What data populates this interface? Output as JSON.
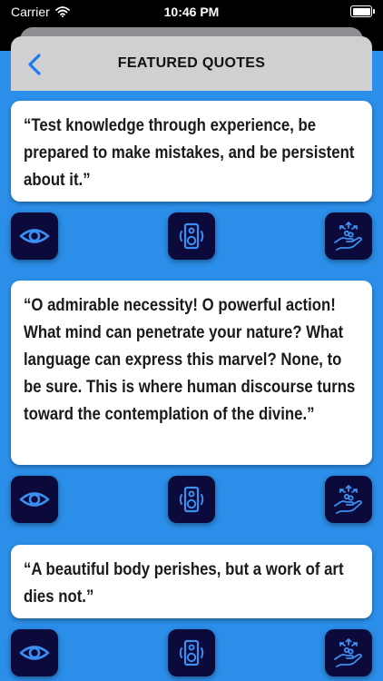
{
  "status_bar": {
    "carrier": "Carrier",
    "time": "10:46 PM"
  },
  "header": {
    "title": "FEATURED QUOTES",
    "back_icon": "chevron-left-icon"
  },
  "quotes": [
    {
      "text": "“Test knowledge through experience, be prepared to make mistakes, and be persistent about it.”"
    },
    {
      "text": "“O admirable necessity! O powerful action! What mind can penetrate your nature? What language can express this marvel? None, to be sure. This is where human discourse turns toward the contemplation of the divine.”"
    },
    {
      "text": "“A beautiful body perishes, but a work of art dies not.”"
    }
  ],
  "actions": [
    "eye-icon",
    "speaker-icon",
    "share-hand-icon"
  ],
  "colors": {
    "background": "#2b8ee8",
    "button": "#0c0a3a",
    "icon_stroke": "#3a8ff0",
    "nav_bar": "#d0d0d3"
  }
}
